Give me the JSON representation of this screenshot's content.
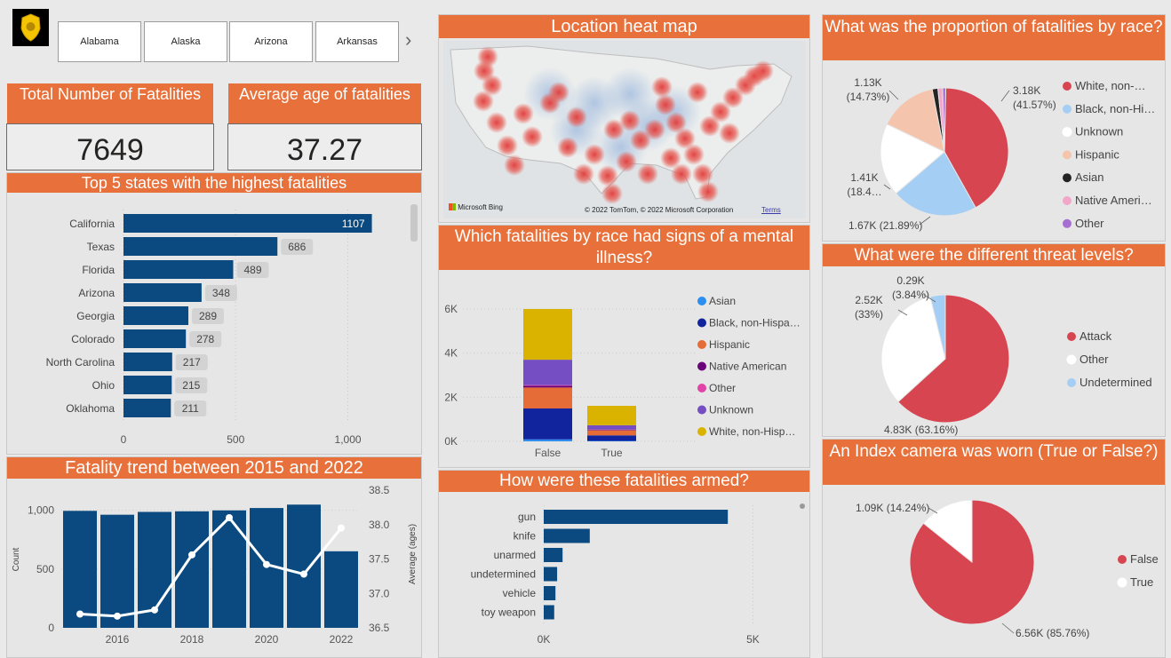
{
  "slicer": {
    "items": [
      "Alabama",
      "Alaska",
      "Arizona",
      "Arkansas"
    ],
    "next_icon": "chevron-right-icon"
  },
  "kpis": {
    "total": {
      "title": "Total Number of Fatalities",
      "value": "7649"
    },
    "avg_age": {
      "title": "Average age of fatalities",
      "value": "37.27"
    }
  },
  "map": {
    "title": "Location heat map",
    "bing_label": "Microsoft Bing",
    "copyright": "© 2022 TomTom, © 2022 Microsoft Corporation",
    "terms": "Terms"
  },
  "colors": {
    "header": "#e8703a",
    "bar_blue": "#0a4a80",
    "red": "#d64550",
    "light_blue": "#a5cef5",
    "white": "#ffffff",
    "peach": "#f4c4ad",
    "black": "#252423",
    "pink": "#f2a6c8",
    "purple": "#a66ed0",
    "asian_blue": "#2c8ef0",
    "navy": "#12239e",
    "orange": "#e66c37",
    "dark_purple": "#6b007b",
    "magenta": "#e044a7",
    "violet": "#744ec2",
    "gold": "#d9b300"
  },
  "chart_data": [
    {
      "id": "top-states",
      "type": "bar",
      "orientation": "horizontal",
      "title": "Top 5 states with the highest fatalities",
      "categories": [
        "California",
        "Texas",
        "Florida",
        "Arizona",
        "Georgia",
        "Colorado",
        "North Carolina",
        "Ohio",
        "Oklahoma"
      ],
      "values": [
        1107,
        686,
        489,
        348,
        289,
        278,
        217,
        215,
        211
      ],
      "data_labels": [
        "1107",
        "686",
        "489",
        "348",
        "289",
        "278",
        "217",
        "215",
        "211"
      ],
      "xlim": [
        0,
        1180
      ],
      "xticks": [
        0,
        500,
        1000
      ],
      "xtick_labels": [
        "0",
        "500",
        "1,000"
      ],
      "grid": true
    },
    {
      "id": "trend",
      "type": "bar+line",
      "title": "Fatality trend between 2015 and 2022",
      "x": [
        2015,
        2016,
        2017,
        2018,
        2019,
        2020,
        2021,
        2022
      ],
      "xtick_labels": [
        "2016",
        "2018",
        "2020",
        "2022"
      ],
      "series": [
        {
          "name": "Count",
          "type": "bar",
          "values": [
            995,
            962,
            986,
            991,
            999,
            1019,
            1048,
            651
          ]
        },
        {
          "name": "Average (ages)",
          "type": "line",
          "values": [
            36.7,
            36.67,
            36.76,
            37.56,
            38.1,
            37.42,
            37.28,
            37.95
          ]
        }
      ],
      "ylabel": "Count",
      "y2label": "Average (ages)",
      "ylim": [
        0,
        1050
      ],
      "yticks": [
        0,
        500,
        1000
      ],
      "ytick_labels": [
        "0",
        "500",
        "1,000"
      ],
      "y2lim": [
        36.5,
        38.5
      ],
      "y2ticks": [
        36.5,
        37.0,
        37.5,
        38.0,
        38.5
      ],
      "y2tick_labels": [
        "36.5",
        "37.0",
        "37.5",
        "38.0",
        "38.5"
      ]
    },
    {
      "id": "mental-illness",
      "type": "bar",
      "stacked": true,
      "title": "Which fatalities by race had signs of a mental illness?",
      "categories": [
        "False",
        "True"
      ],
      "series": [
        {
          "name": "Asian",
          "values": [
            90,
            20
          ]
        },
        {
          "name": "Black, non-Hispanic",
          "values": [
            1400,
            250
          ]
        },
        {
          "name": "Hispanic",
          "values": [
            950,
            230
          ]
        },
        {
          "name": "Native American",
          "values": [
            80,
            20
          ]
        },
        {
          "name": "Other",
          "values": [
            30,
            10
          ]
        },
        {
          "name": "Unknown",
          "values": [
            1150,
            200
          ]
        },
        {
          "name": "White, non-Hispanic",
          "values": [
            2300,
            880
          ]
        }
      ],
      "legend_labels": [
        "Asian",
        "Black, non-Hispa…",
        "Hispanic",
        "Native American",
        "Other",
        "Unknown",
        "White, non-Hisp…"
      ],
      "ylim": [
        0,
        6200
      ],
      "yticks": [
        0,
        2000,
        4000,
        6000
      ],
      "ytick_labels": [
        "0K",
        "2K",
        "4K",
        "6K"
      ],
      "legend": "right"
    },
    {
      "id": "armed",
      "type": "bar",
      "orientation": "horizontal",
      "title": "How were these fatalities armed?",
      "categories": [
        "gun",
        "knife",
        "unarmed",
        "undetermined",
        "vehicle",
        "toy weapon"
      ],
      "values": [
        4400,
        1100,
        450,
        320,
        280,
        250
      ],
      "xlim": [
        0,
        5500
      ],
      "xticks": [
        0,
        5000
      ],
      "xtick_labels": [
        "0K",
        "5K"
      ]
    },
    {
      "id": "race-proportion",
      "type": "pie",
      "title": "What was the proportion of fatalities by race?",
      "categories": [
        "White, non-Hispanic",
        "Black, non-Hispanic",
        "Unknown",
        "Hispanic",
        "Asian",
        "Native American",
        "Other"
      ],
      "legend_labels": [
        "White, non-…",
        "Black, non-Hi…",
        "Unknown",
        "Hispanic",
        "Asian",
        "Native Ameri…",
        "Other"
      ],
      "values": [
        3180,
        1670,
        1410,
        1130,
        110,
        90,
        60
      ],
      "data_labels": [
        [
          "3.18K",
          "(41.57%)"
        ],
        [
          "1.67K (21.89%)"
        ],
        [
          "1.41K",
          "(18.4…"
        ],
        [
          "1.13K",
          "(14.73%)"
        ]
      ],
      "legend": "right"
    },
    {
      "id": "threat-levels",
      "type": "pie",
      "title": "What were the different threat levels?",
      "categories": [
        "Attack",
        "Other",
        "Undetermined"
      ],
      "values": [
        4830,
        2520,
        290
      ],
      "data_labels": [
        [
          "4.83K (63.16%)"
        ],
        [
          "2.52K",
          "(33%)"
        ],
        [
          "0.29K",
          "(3.84%)"
        ]
      ],
      "legend": "right"
    },
    {
      "id": "body-camera",
      "type": "pie",
      "title": "An Index camera was worn (True or False?)",
      "categories": [
        "False",
        "True"
      ],
      "values": [
        6560,
        1090
      ],
      "data_labels": [
        [
          "6.56K (85.76%)"
        ],
        [
          "1.09K (14.24%)"
        ]
      ],
      "legend": "right"
    }
  ]
}
